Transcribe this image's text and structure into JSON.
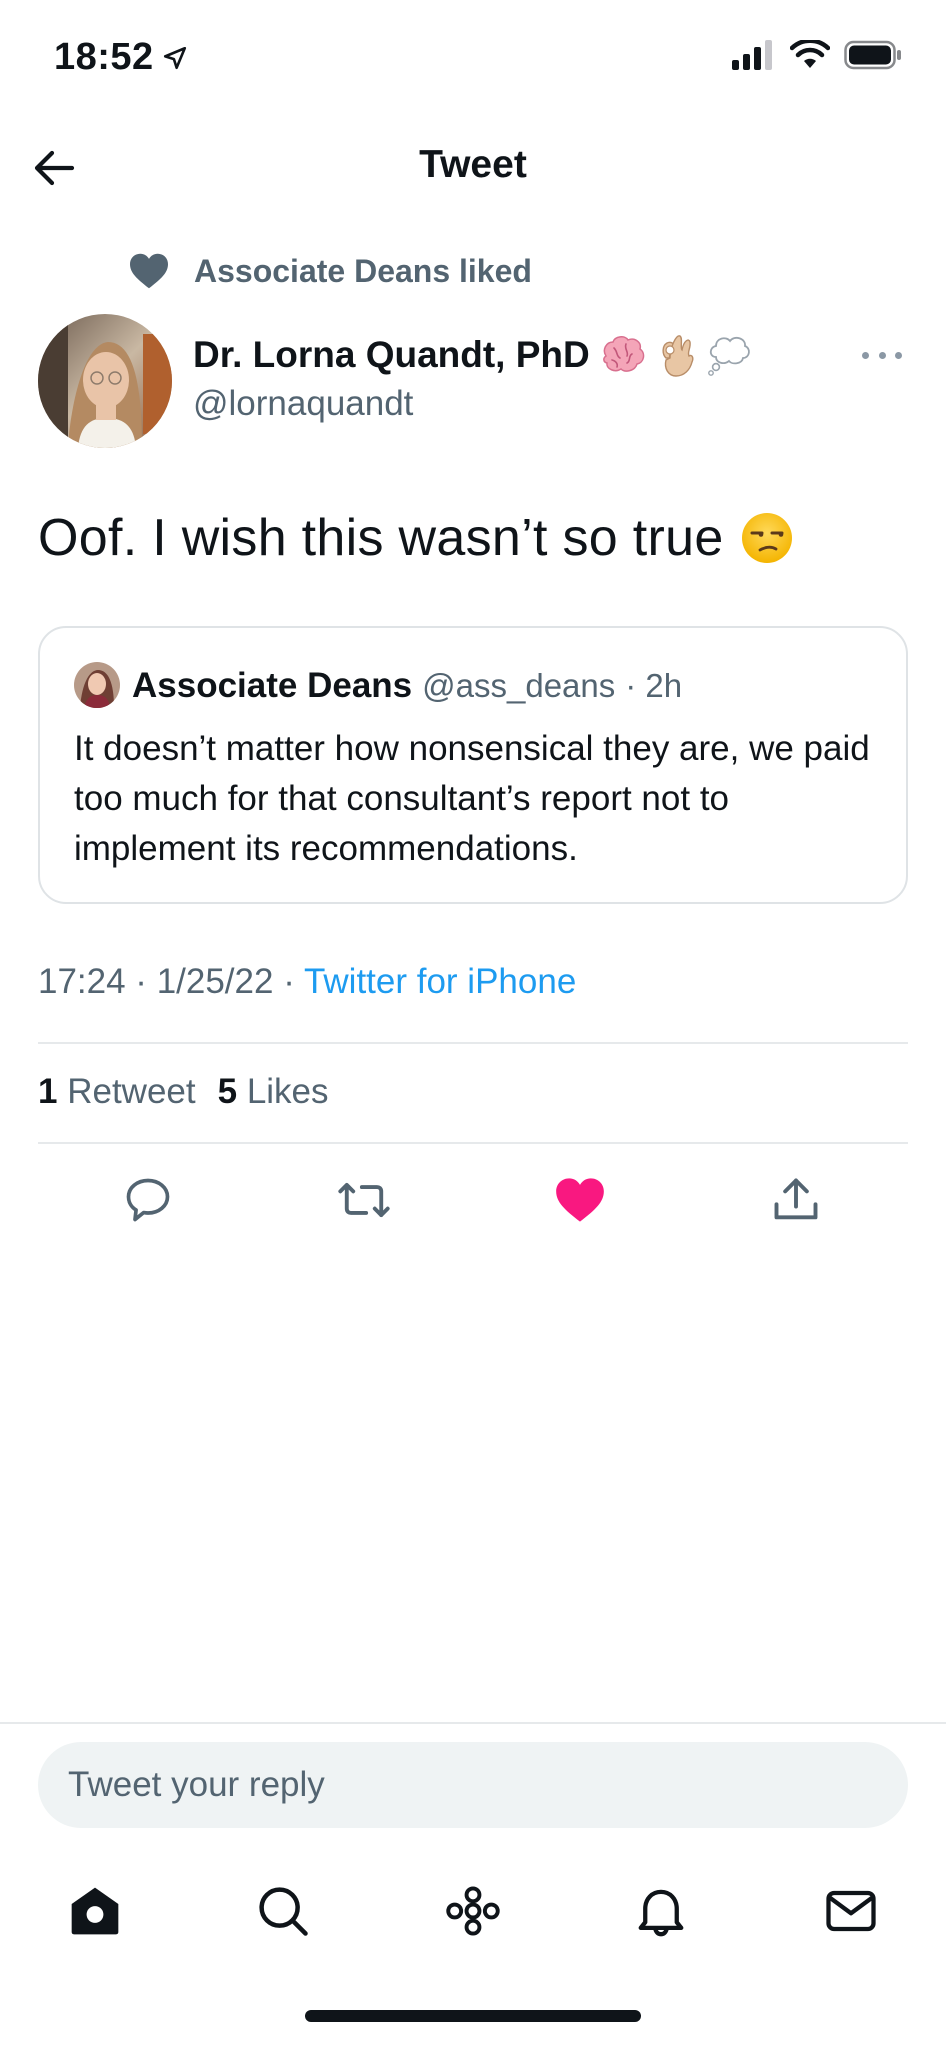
{
  "status_bar": {
    "time": "18:52",
    "location_icon": "location-arrow-icon",
    "signal_icon": "cellular-signal-icon",
    "wifi_icon": "wifi-icon",
    "battery_icon": "battery-icon"
  },
  "header": {
    "back_icon": "back-arrow-icon",
    "title": "Tweet"
  },
  "social_context": {
    "icon": "heart-icon",
    "text": "Associate Deans liked"
  },
  "tweet": {
    "author_name": "Dr. Lorna Quandt, PhD",
    "author_name_emojis": [
      "brain-emoji",
      "ok-hand-emoji",
      "thought-balloon-emoji"
    ],
    "author_handle": "@lornaquandt",
    "more_icon": "more-options-icon",
    "text": "Oof. I wish this wasn’t so true",
    "text_emoji": "unamused-face-emoji",
    "timestamp": "17:24 · 1/25/22 · ",
    "source": "Twitter for iPhone",
    "retweets_count": "1",
    "retweets_label": "Retweet",
    "likes_count": "5",
    "likes_label": "Likes"
  },
  "quoted_tweet": {
    "author_name": "Associate Deans",
    "author_handle": "@ass_deans",
    "time": "· 2h",
    "text": "It doesn’t matter how nonsensical they are, we paid too much for that consultant’s report not to implement its recommendations."
  },
  "actions": [
    {
      "name": "reply-icon"
    },
    {
      "name": "retweet-icon"
    },
    {
      "name": "like-icon",
      "active": true,
      "color": "#f91880"
    },
    {
      "name": "share-icon"
    }
  ],
  "reply": {
    "placeholder": "Tweet your reply"
  },
  "tab_bar": [
    {
      "name": "home-icon",
      "active": true
    },
    {
      "name": "search-icon"
    },
    {
      "name": "spaces-icon"
    },
    {
      "name": "notifications-icon"
    },
    {
      "name": "messages-icon"
    }
  ],
  "colors": {
    "text_primary": "#0f1419",
    "text_secondary": "#536471",
    "link": "#1d9bf0",
    "like_active": "#f91880",
    "border": "#e6e9eb"
  }
}
